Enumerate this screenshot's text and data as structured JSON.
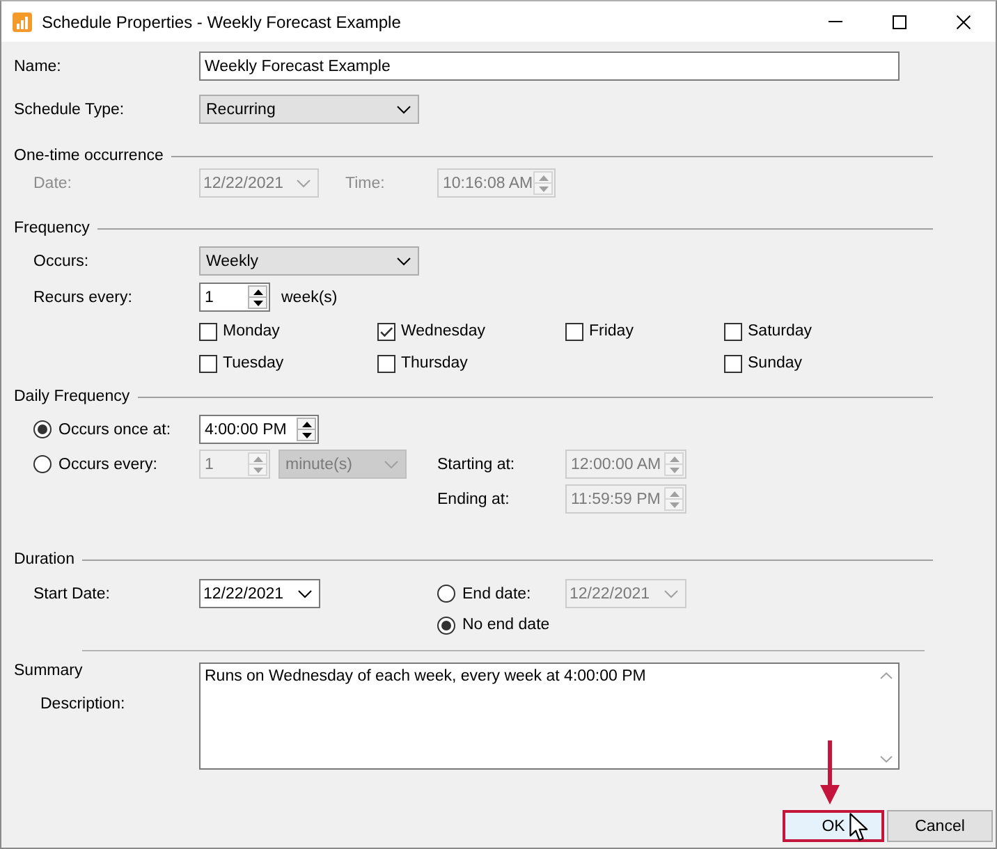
{
  "window": {
    "title": "Schedule Properties - Weekly Forecast Example"
  },
  "name": {
    "label": "Name:",
    "value": "Weekly Forecast Example"
  },
  "schedule_type": {
    "label": "Schedule Type:",
    "value": "Recurring"
  },
  "one_time_occurrence": {
    "title": "One-time occurrence",
    "disabled": true,
    "date": {
      "label": "Date:",
      "value": "12/22/2021"
    },
    "time": {
      "label": "Time:",
      "value": "10:16:08 AM"
    }
  },
  "frequency": {
    "title": "Frequency",
    "occurs": {
      "label": "Occurs:",
      "value": "Weekly"
    },
    "recurs_every": {
      "label": "Recurs every:",
      "value": "1",
      "unit": "week(s)"
    },
    "day_columns": [
      [
        {
          "label": "Monday",
          "checked": false
        },
        {
          "label": "Tuesday",
          "checked": false
        }
      ],
      [
        {
          "label": "Wednesday",
          "checked": true
        },
        {
          "label": "Thursday",
          "checked": false
        }
      ],
      [
        {
          "label": "Friday",
          "checked": false
        }
      ],
      [
        {
          "label": "Saturday",
          "checked": false
        },
        {
          "label": "Sunday",
          "checked": false
        }
      ]
    ]
  },
  "daily_frequency": {
    "title": "Daily Frequency",
    "options": [
      {
        "kind": "once",
        "label": "Occurs once at:",
        "selected": true,
        "value": "4:00:00 PM",
        "disabled": false
      },
      {
        "kind": "every",
        "label": "Occurs every:",
        "selected": false,
        "value": "1",
        "unit": "minute(s)",
        "disabled": true
      }
    ],
    "starting_at": {
      "label": "Starting at:",
      "value": "12:00:00 AM",
      "disabled": true
    },
    "ending_at": {
      "label": "Ending at:",
      "value": "11:59:59 PM",
      "disabled": true
    }
  },
  "duration": {
    "title": "Duration",
    "start_date": {
      "label": "Start Date:",
      "value": "12/22/2021"
    },
    "end_options": [
      {
        "kind": "date",
        "label": "End date:",
        "selected": false,
        "value": "12/22/2021",
        "disabled": true
      },
      {
        "kind": "none",
        "label": "No end date",
        "selected": true
      }
    ]
  },
  "summary": {
    "title": "Summary",
    "description": {
      "label": "Description:",
      "value": "Runs on Wednesday of each week, every week at 4:00:00 PM"
    }
  },
  "buttons": [
    {
      "kind": "ok",
      "label": "OK",
      "highlighted": true,
      "pointer": true
    },
    {
      "kind": "cancel",
      "label": "Cancel",
      "highlighted": false,
      "pointer": false
    }
  ]
}
